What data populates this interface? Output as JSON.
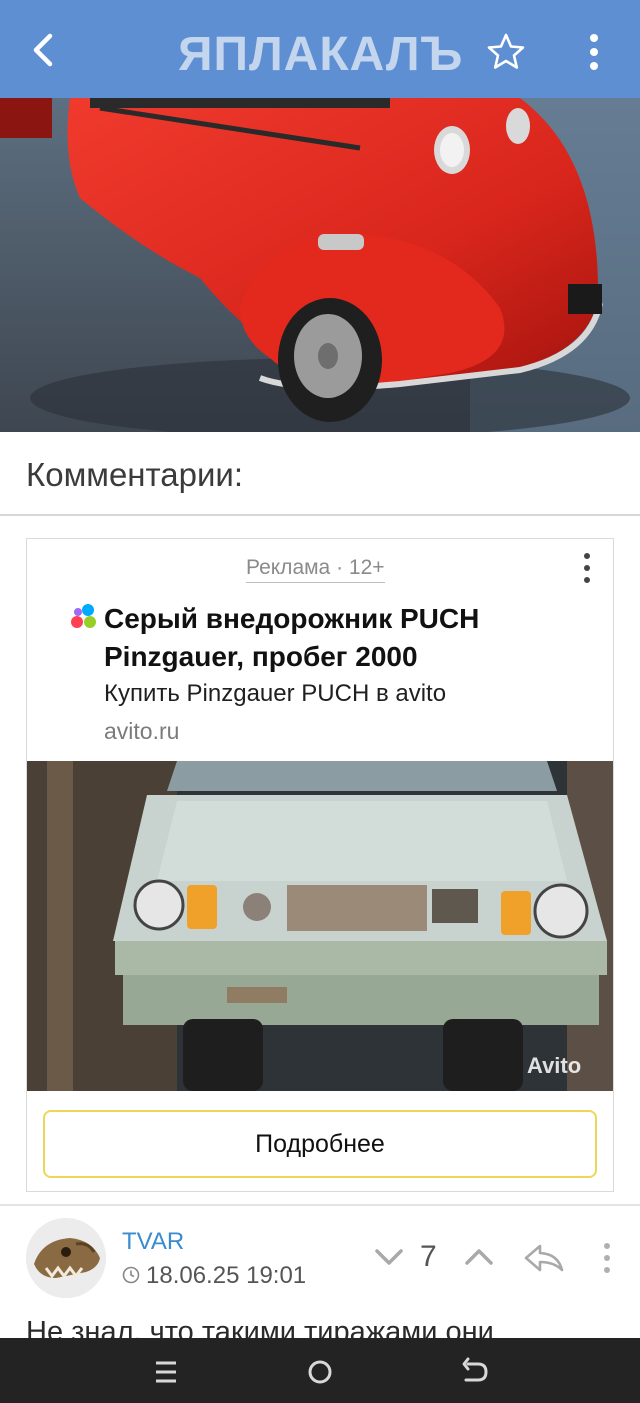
{
  "header": {
    "logo_text": "ЯПЛАКАЛЪ",
    "icons": {
      "back": "chevron-left-icon",
      "favorite": "star-outline-icon",
      "menu": "vertical-dots-icon"
    },
    "bar_color": "#5f8fd3"
  },
  "comments_section": {
    "title": "Комментарии:"
  },
  "ad": {
    "label": "Реклама · 12+",
    "title": "Серый внедорожник PUCH Pinzgauer, пробег 2000",
    "subtitle": "Купить Pinzgauer PUCH в avito",
    "domain": "avito.ru",
    "watermark": "Avito",
    "button_label": "Подробнее",
    "button_border_color": "#ecd75a",
    "favicon_colors": [
      "#00aaff",
      "#ff4053",
      "#97cf26",
      "#a169f7"
    ]
  },
  "comment": {
    "author": "TVAR",
    "date": "18.06.25 19:01",
    "rating": "7",
    "text": "Не знал, что такими тиражами они"
  },
  "system_nav": {
    "icons": [
      "recents-icon",
      "home-icon",
      "back-icon"
    ]
  }
}
